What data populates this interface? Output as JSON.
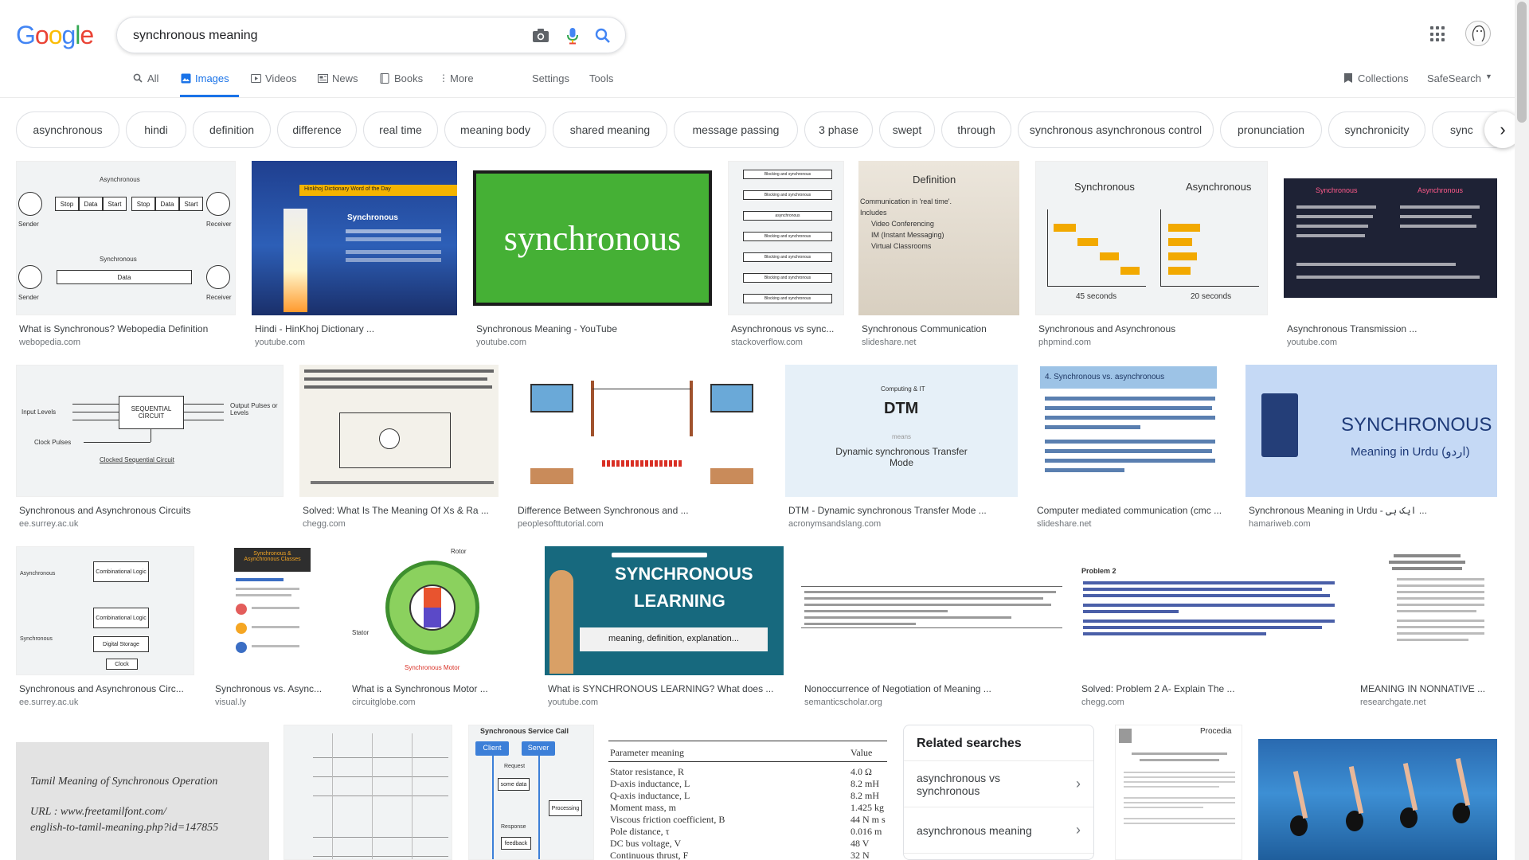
{
  "logo_letters": [
    {
      "ch": "G",
      "color": "#4285F4"
    },
    {
      "ch": "o",
      "color": "#EA4335"
    },
    {
      "ch": "o",
      "color": "#FBBC05"
    },
    {
      "ch": "g",
      "color": "#4285F4"
    },
    {
      "ch": "l",
      "color": "#34A853"
    },
    {
      "ch": "e",
      "color": "#EA4335"
    }
  ],
  "search": {
    "value": "synchronous meaning"
  },
  "icons": {
    "camera": "camera-icon",
    "mic": "mic-icon",
    "search": "search-icon",
    "apps": "apps-grid-icon"
  },
  "tabs": [
    {
      "label": "All",
      "icon": "search-icon"
    },
    {
      "label": "Images",
      "icon": "image-icon",
      "active": true
    },
    {
      "label": "Videos",
      "icon": "video-icon"
    },
    {
      "label": "News",
      "icon": "news-icon"
    },
    {
      "label": "Books",
      "icon": "book-icon"
    },
    {
      "label": "More",
      "icon": "more-vert-icon"
    },
    {
      "label": "Settings"
    },
    {
      "label": "Tools"
    }
  ],
  "right_tools": {
    "collections": "Collections",
    "safesearch": "SafeSearch"
  },
  "chips": [
    "asynchronous",
    "hindi",
    "definition",
    "difference",
    "real time",
    "meaning body",
    "shared meaning",
    "message passing",
    "3 phase",
    "swept",
    "through",
    "synchronous asynchronous control",
    "pronunciation",
    "synchronicity",
    "sync"
  ],
  "results": [
    {
      "title": "What is Synchronous? Webopedia Definition",
      "site": "webopedia.com"
    },
    {
      "title": "Hindi - HinKhoj Dictionary ...",
      "site": "youtube.com"
    },
    {
      "title": "Synchronous Meaning - YouTube",
      "site": "youtube.com"
    },
    {
      "title": "Asynchronous vs sync...",
      "site": "stackoverflow.com"
    },
    {
      "title": "Synchronous Communication",
      "site": "slideshare.net"
    },
    {
      "title": "Synchronous and Asynchronous",
      "site": "phpmind.com"
    },
    {
      "title": "Asynchronous Transmission ...",
      "site": "youtube.com"
    },
    {
      "title": "Synchronous and Asynchronous Circuits",
      "site": "ee.surrey.ac.uk"
    },
    {
      "title": "Solved: What Is The Meaning Of Xs & Ra ...",
      "site": "chegg.com"
    },
    {
      "title": "Difference Between Synchronous and ...",
      "site": "peoplesofttutorial.com"
    },
    {
      "title": "DTM - Dynamic synchronous Transfer Mode ...",
      "site": "acronymsandslang.com"
    },
    {
      "title": "Computer mediated communication (cmc ...",
      "site": "slideshare.net"
    },
    {
      "title": "Synchronous Meaning in Urdu - ایک ہی ...",
      "site": "hamariweb.com"
    },
    {
      "title": "Synchronous and Asynchronous Circ...",
      "site": "ee.surrey.ac.uk"
    },
    {
      "title": "Synchronous vs. Async...",
      "site": "visual.ly"
    },
    {
      "title": "What is a Synchronous Motor ...",
      "site": "circuitglobe.com"
    },
    {
      "title": "What is SYNCHRONOUS LEARNING? What does ...",
      "site": "youtube.com"
    },
    {
      "title": "Nonoccurrence of Negotiation of Meaning ...",
      "site": "semanticscholar.org"
    },
    {
      "title": "Solved: Problem 2 A- Explain The ...",
      "site": "chegg.com"
    },
    {
      "title": "MEANING IN NONNATIVE ...",
      "site": "researchgate.net"
    }
  ],
  "thumb_text": {
    "webopedia_top": "Asynchronous",
    "webopedia_bottom": "Synchronous",
    "webopedia_sender": "Sender",
    "webopedia_receiver": "Receiver",
    "webopedia_stop": "Stop",
    "webopedia_data": "Data",
    "webopedia_start": "Start",
    "hinkhoj_banner": "Hinkhoj Dictionary Word of the Day",
    "hinkhoj_word": "Synchronous",
    "green_word": "synchronous",
    "so_label1": "Blocking and synchronous",
    "so_label2": "asynchronous",
    "slideshare_title": "Definition",
    "slideshare_line1": "Communication in 'real time'.",
    "slideshare_line2": "Includes",
    "slideshare_line3": "Video Conferencing",
    "slideshare_line4": "IM (Instant Messaging)",
    "slideshare_line5": "Virtual Classrooms",
    "php_sync": "Synchronous",
    "php_async": "Asynchronous",
    "php_left_total": "45 seconds",
    "php_right_total": "20 seconds",
    "yt2_sync": "Synchronous",
    "yt2_async": "Asynchronous",
    "seq_center": "SEQUENTIAL CIRCUIT",
    "seq_input": "Input Levels",
    "seq_output": "Output Pulses or Levels",
    "seq_clock": "Clock Pulses",
    "seq_caption": "Clocked Sequential Circuit",
    "dtm_top": "Computing & IT",
    "dtm_big": "DTM",
    "dtm_means": "means",
    "dtm_sub": "Dynamic synchronous Transfer Mode",
    "cmc_header": "4. Synchronous vs. asynchronous",
    "urdu_big": "SYNCHRONOUS",
    "urdu_sub": "Meaning in Urdu (اردو)",
    "comb_logic": "Combinational Logic",
    "comb_async": "Asynchronous",
    "comb_sync": "Synchronous",
    "comb_storage": "Digital Storage",
    "comb_clock": "Clock",
    "visually_title": "Synchronous & Asynchronous Classes",
    "motor_label": "Synchronous Motor",
    "motor_rotor": "Rotor",
    "motor_stator": "Stator",
    "learn_big1": "SYNCHRONOUS",
    "learn_big2": "LEARNING",
    "learn_sub": "meaning, definition, explanation...",
    "chegg2_head": "Problem 2",
    "tamil_line1": "Tamil Meaning of Synchronous Operation",
    "tamil_line2": "URL : www.freetamilfont.com/",
    "tamil_line3": "english-to-tamil-meaning.php?id=147855",
    "svc_title": "Synchronous Service Call",
    "svc_client": "Client",
    "svc_server": "Server",
    "svc_request": "Request",
    "svc_somedata": "some data",
    "svc_processing": "Processing",
    "svc_response": "Response",
    "svc_feedback": "feedback",
    "param_header": "Parameter meaning",
    "param_value": "Value",
    "procedia": "Procedia"
  },
  "param_table": [
    {
      "name": "Stator resistance, R",
      "value": "4.0 Ω"
    },
    {
      "name": "D-axis inductance, L",
      "value": "8.2 mH"
    },
    {
      "name": "Q-axis inductance, L",
      "value": "8.2 mH"
    },
    {
      "name": "Moment mass, m",
      "value": "1.425 kg"
    },
    {
      "name": "Viscous friction coefficient, B",
      "value": "44 N m s"
    },
    {
      "name": "Pole distance, τ",
      "value": "0.016 m"
    },
    {
      "name": "DC bus voltage, V",
      "value": "48 V"
    },
    {
      "name": "Continuous thrust, F",
      "value": "32 N"
    }
  ],
  "related": {
    "title": "Related searches",
    "items": [
      "asynchronous vs synchronous",
      "asynchronous meaning"
    ]
  }
}
